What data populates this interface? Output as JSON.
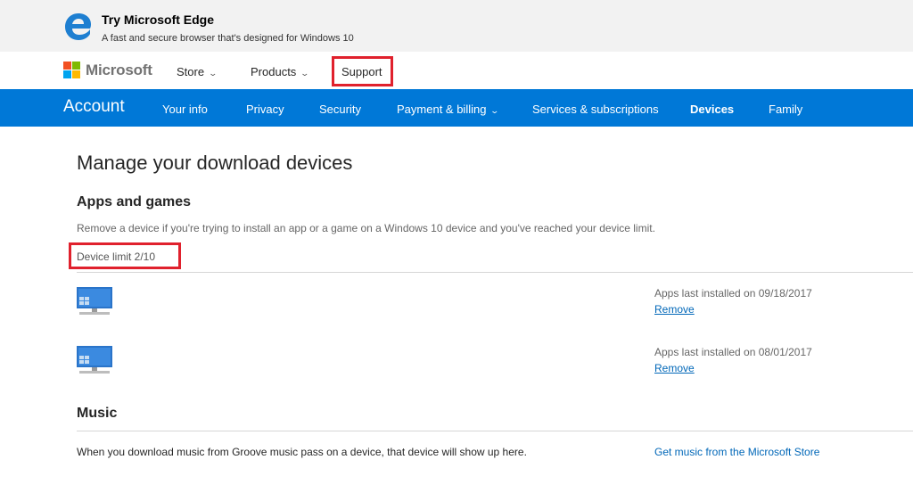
{
  "promo": {
    "title": "Try Microsoft Edge",
    "subtitle": "A fast and secure browser that's designed for Windows 10",
    "icon": "edge-logo-icon"
  },
  "header": {
    "brand": "Microsoft",
    "nav": [
      {
        "label": "Store",
        "has_dropdown": true
      },
      {
        "label": "Products",
        "has_dropdown": true
      },
      {
        "label": "Support",
        "has_dropdown": false,
        "highlighted": true
      }
    ]
  },
  "account_bar": {
    "title": "Account",
    "items": [
      {
        "label": "Your info"
      },
      {
        "label": "Privacy"
      },
      {
        "label": "Security"
      },
      {
        "label": "Payment & billing",
        "has_dropdown": true
      },
      {
        "label": "Services & subscriptions"
      },
      {
        "label": "Devices",
        "active": true
      },
      {
        "label": "Family"
      }
    ],
    "color": "#0078d7"
  },
  "main": {
    "title": "Manage your download devices",
    "apps": {
      "heading": "Apps and games",
      "description": "Remove a device if you're trying to install an app or a game on a Windows 10 device and you've reached your device limit.",
      "device_limit": "Device limit 2/10",
      "devices": [
        {
          "installed": "Apps last installed on 09/18/2017",
          "action": "Remove",
          "icon": "desktop-pc-icon"
        },
        {
          "installed": "Apps last installed on 08/01/2017",
          "action": "Remove",
          "icon": "desktop-pc-icon"
        }
      ]
    },
    "music": {
      "heading": "Music",
      "description": "When you download music from Groove music pass on a device, that device will show up here.",
      "link": "Get music from the Microsoft Store"
    }
  },
  "colors": {
    "highlight_border": "#e0212d",
    "link": "#0067b8"
  }
}
